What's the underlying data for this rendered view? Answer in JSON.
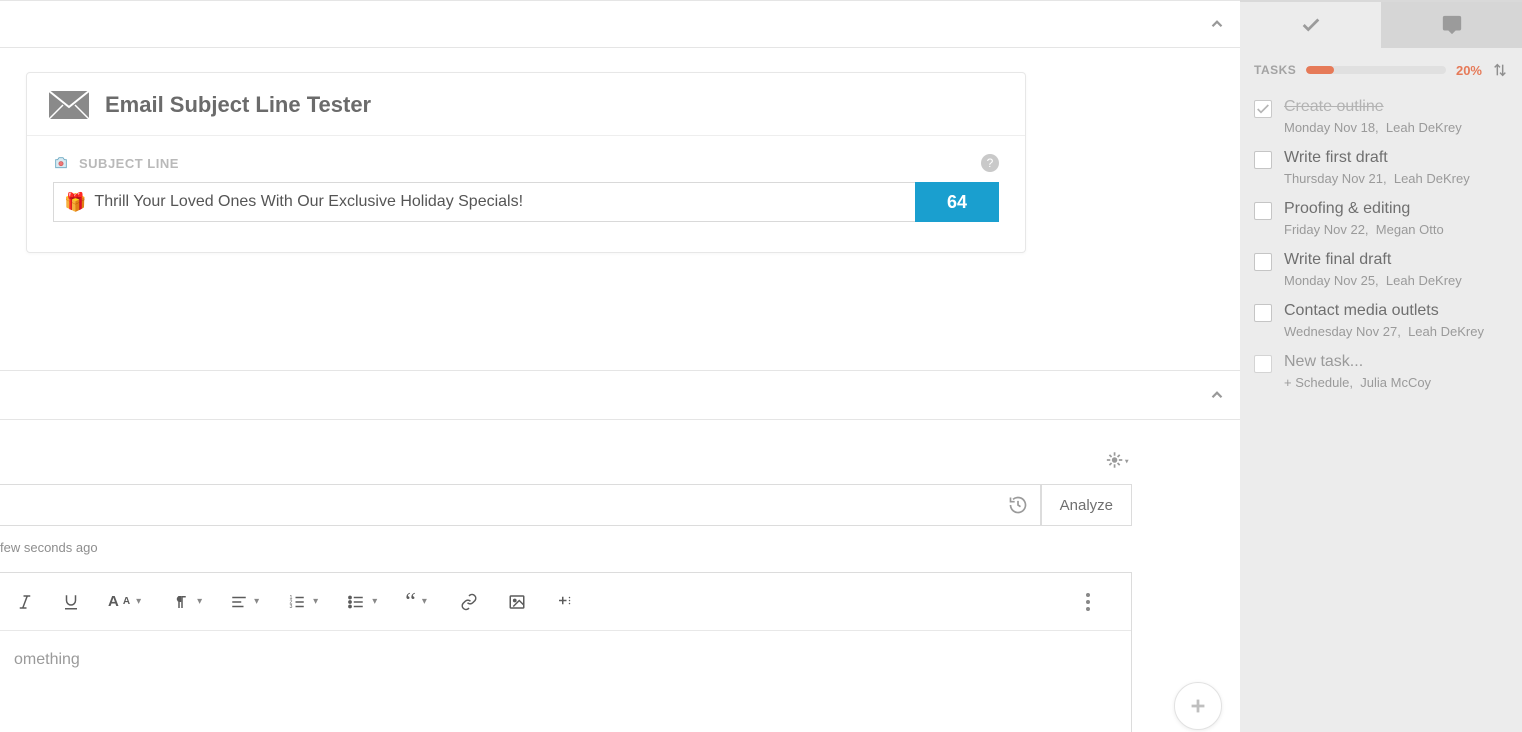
{
  "card": {
    "title": "Email Subject Line Tester",
    "field_label": "SUBJECT LINE",
    "subject_emoji": "🎁",
    "subject_text": "Thrill Your Loved Ones With Our Exclusive Holiday Specials!",
    "score": "64"
  },
  "editor": {
    "analyze_label": "Analyze",
    "saved_label": "few seconds ago",
    "placeholder": "omething"
  },
  "sidebar": {
    "tasks_label": "TASKS",
    "percent": "20%",
    "items": [
      {
        "title": "Create outline",
        "date": "Monday Nov 18,",
        "assignee": "Leah DeKrey",
        "done": true
      },
      {
        "title": "Write first draft",
        "date": "Thursday Nov 21,",
        "assignee": "Leah DeKrey",
        "done": false
      },
      {
        "title": "Proofing & editing",
        "date": "Friday Nov 22,",
        "assignee": "Megan Otto",
        "done": false
      },
      {
        "title": "Write final draft",
        "date": "Monday Nov 25,",
        "assignee": "Leah DeKrey",
        "done": false
      },
      {
        "title": "Contact media outlets",
        "date": "Wednesday Nov 27,",
        "assignee": "Leah DeKrey",
        "done": false
      }
    ],
    "new_task": {
      "title": "New task...",
      "schedule": "+ Schedule,",
      "assignee": "Julia McCoy"
    }
  }
}
